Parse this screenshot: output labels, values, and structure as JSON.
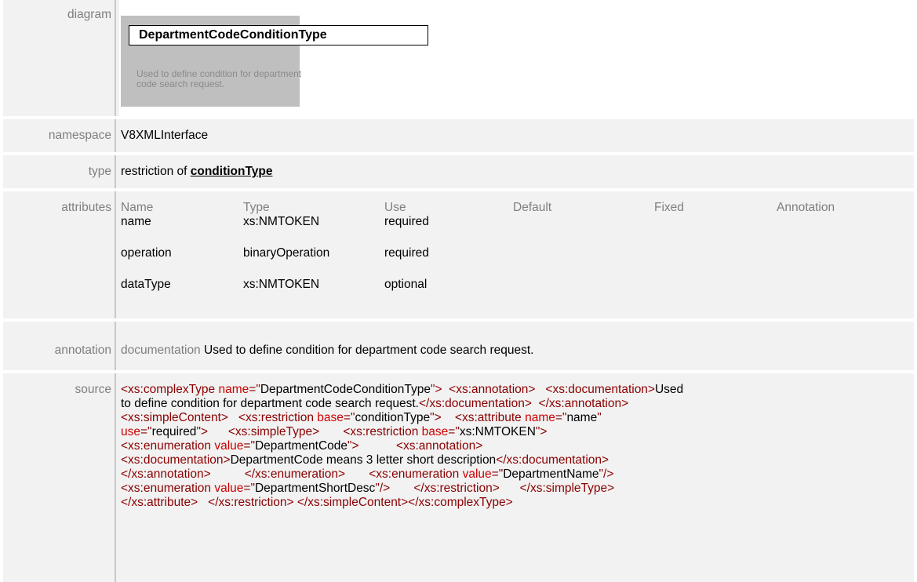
{
  "diagram": {
    "label": "diagram",
    "type_name": "DepartmentCodeConditionType",
    "doc_line1": "Used to define condition for department",
    "doc_line2": "code search request."
  },
  "namespace": {
    "label": "namespace",
    "value": "V8XMLInterface"
  },
  "type": {
    "label": "type",
    "prefix": "restriction of",
    "base": "conditionType"
  },
  "attributes": {
    "label": "attributes",
    "headers": [
      "Name",
      "Type",
      "Use",
      "Default",
      "Fixed",
      "Annotation"
    ],
    "rows": [
      {
        "name": "name",
        "type": "xs:NMTOKEN",
        "use": "required"
      },
      {
        "name": "operation",
        "type": "binaryOperation",
        "use": "required"
      },
      {
        "name": "dataType",
        "type": "xs:NMTOKEN",
        "use": "optional"
      }
    ]
  },
  "annotation": {
    "label": "annotation",
    "key": "documentation",
    "text": "Used to define condition for department code search request."
  },
  "source": {
    "label": "source",
    "lines": [
      [
        [
          "t",
          "<xs:complexType "
        ],
        [
          "an",
          "name"
        ],
        [
          "t",
          "=\""
        ],
        [
          "v",
          "DepartmentCodeConditionType"
        ],
        [
          "t",
          "\"> "
        ],
        [
          "v",
          " "
        ],
        [
          "t",
          "<xs:annotation>"
        ],
        [
          "v",
          "   "
        ],
        [
          "t",
          "<xs:documentation>"
        ],
        [
          "v",
          "Used"
        ]
      ],
      [
        [
          "v",
          "to define condition for department code search request."
        ],
        [
          "t",
          "</xs:documentation>"
        ],
        [
          "v",
          "  "
        ],
        [
          "t",
          "</xs:annotation>"
        ]
      ],
      [
        [
          "t",
          "<xs:simpleContent>"
        ],
        [
          "v",
          "   "
        ],
        [
          "t",
          "<xs:restriction "
        ],
        [
          "an",
          "base"
        ],
        [
          "t",
          "=\""
        ],
        [
          "v",
          "conditionType"
        ],
        [
          "t",
          "\">"
        ],
        [
          "v",
          "    "
        ],
        [
          "t",
          "<xs:attribute "
        ],
        [
          "an",
          "name"
        ],
        [
          "t",
          "=\""
        ],
        [
          "v",
          "name"
        ],
        [
          "t",
          "\""
        ]
      ],
      [
        [
          "an",
          "use"
        ],
        [
          "t",
          "=\""
        ],
        [
          "v",
          "required"
        ],
        [
          "t",
          "\">"
        ],
        [
          "v",
          "      "
        ],
        [
          "t",
          "<xs:simpleType>"
        ],
        [
          "v",
          "       "
        ],
        [
          "t",
          "<xs:restriction "
        ],
        [
          "an",
          "base"
        ],
        [
          "t",
          "=\""
        ],
        [
          "v",
          "xs:NMTOKEN"
        ],
        [
          "t",
          "\">"
        ]
      ],
      [
        [
          "t",
          "<xs:enumeration "
        ],
        [
          "an",
          "value"
        ],
        [
          "t",
          "=\""
        ],
        [
          "v",
          "DepartmentCode"
        ],
        [
          "t",
          "\">"
        ],
        [
          "v",
          "           "
        ],
        [
          "t",
          "<xs:annotation>"
        ]
      ],
      [
        [
          "t",
          "<xs:documentation>"
        ],
        [
          "v",
          "DepartmentCode means 3 letter short description"
        ],
        [
          "t",
          "</xs:documentation>"
        ]
      ],
      [
        [
          "t",
          "</xs:annotation>"
        ],
        [
          "v",
          "          "
        ],
        [
          "t",
          "</xs:enumeration>"
        ],
        [
          "v",
          "       "
        ],
        [
          "t",
          "<xs:enumeration "
        ],
        [
          "an",
          "value"
        ],
        [
          "t",
          "=\""
        ],
        [
          "v",
          "DepartmentName"
        ],
        [
          "t",
          "\"/>"
        ]
      ],
      [
        [
          "t",
          "<xs:enumeration "
        ],
        [
          "an",
          "value"
        ],
        [
          "t",
          "=\""
        ],
        [
          "v",
          "DepartmentShortDesc"
        ],
        [
          "t",
          "\"/>"
        ],
        [
          "v",
          "       "
        ],
        [
          "t",
          "</xs:restriction>"
        ],
        [
          "v",
          "      "
        ],
        [
          "t",
          "</xs:simpleType>"
        ]
      ],
      [
        [
          "t",
          "</xs:attribute>"
        ],
        [
          "v",
          "   "
        ],
        [
          "t",
          "</xs:restriction>"
        ],
        [
          "v",
          " "
        ],
        [
          "t",
          "</xs:simpleContent>"
        ],
        [
          "t",
          "</xs:complexType>"
        ]
      ]
    ]
  },
  "colors": {
    "row_bg": "#f2f2f2",
    "label": "#7f7f7f",
    "tag": "#8b0000",
    "attr_name": "#cc0000",
    "diagram_bg": "#bfbfbf"
  }
}
